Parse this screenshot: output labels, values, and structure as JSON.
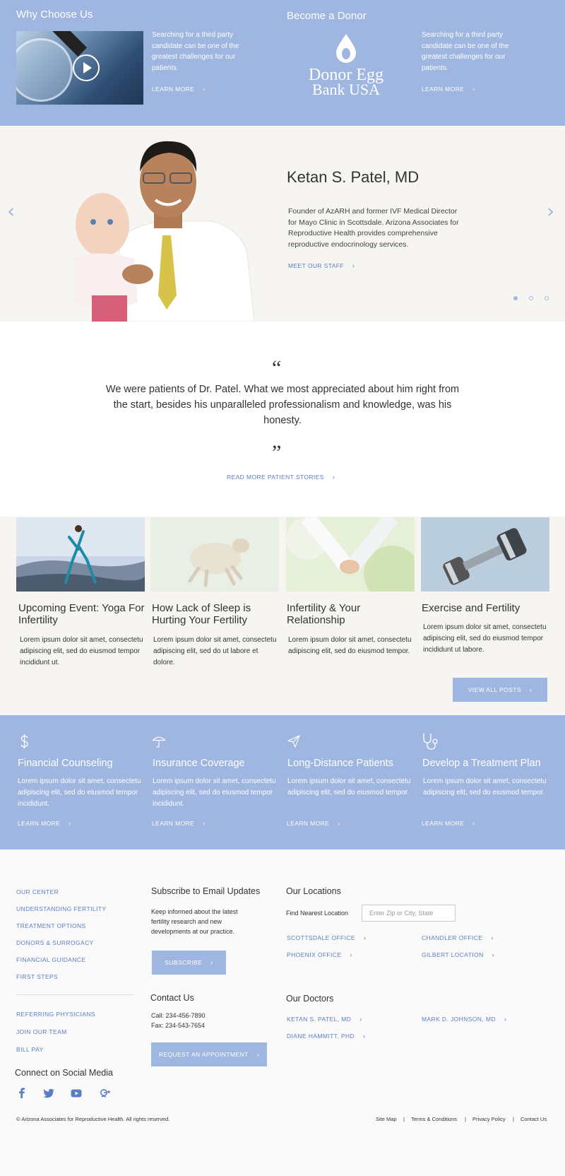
{
  "top": {
    "why": {
      "heading": "Why Choose Us",
      "text": "Searching for a third party candidate can be one of the greatest challenges for our patients.",
      "link": "LEARN MORE"
    },
    "donor": {
      "heading": "Become a Donor",
      "logo_line1": "Donor Egg",
      "logo_line2": "Bank USA",
      "text": "Searching for a third party candidate can be one of the greatest challenges for our patients.",
      "link": "LEARN MORE"
    }
  },
  "hero": {
    "name": "Ketan S. Patel, MD",
    "bio": "Founder of AzARH and former IVF Medical Director for Mayo Clinic in Scottsdale. Arizona Associates for Reproductive Health provides comprehensive reproductive endocrinology services.",
    "link": "MEET OUR STAFF",
    "slide_count": 3,
    "active_slide": 1
  },
  "testimonial": {
    "open_quote": "“",
    "close_quote": "”",
    "text": "We were patients of Dr. Patel. What we most appreciated about him right from the start, besides his unparalleled professionalism and knowledge, was his honesty.",
    "link": "READ MORE PATIENT STORIES"
  },
  "posts": [
    {
      "title": "Upcoming Event: Yoga For Infertility",
      "excerpt": "Lorem ipsum dolor sit amet, consectetu adipiscing elit, sed do eiusmod tempor incididunt ut."
    },
    {
      "title": "How Lack of Sleep is Hurting Your Fertility",
      "excerpt": "Lorem ipsum dolor sit amet, consectetu adipiscing elit, sed do ut labore et dolore."
    },
    {
      "title": "Infertility & Your Relationship",
      "excerpt": "Lorem ipsum dolor sit amet, consectetu adipiscing elit, sed do eiusmod tempor."
    },
    {
      "title": "Exercise and Fertility",
      "excerpt": "Lorem ipsum dolor sit amet, consectetu adipiscing elit, sed do eiusmod tempor incididunt ut labore."
    }
  ],
  "view_all": "VIEW ALL POSTS",
  "services": [
    {
      "icon": "dollar-icon",
      "title": "Financial Counseling",
      "text": "Lorem ipsum dolor sit amet, consectetu adipiscing elit, sed do eiusmod tempor incididunt.",
      "link": "LEARN MORE"
    },
    {
      "icon": "umbrella-icon",
      "title": "Insurance Coverage",
      "text": "Lorem ipsum dolor sit amet, consectetu adipiscing elit, sed do eiusmod tempor incididunt.",
      "link": "LEARN MORE"
    },
    {
      "icon": "paper-plane-icon",
      "title": "Long-Distance Patients",
      "text": "Lorem ipsum dolor sit amet, consectetu adipiscing elit, sed do eiusmod tempor.",
      "link": "LEARN MORE"
    },
    {
      "icon": "stethoscope-icon",
      "title": "Develop a Treatment Plan",
      "text": "Lorem ipsum dolor sit amet, consectetu adipiscing elit, sed do eiusmod tempor.",
      "link": "LEARN MORE"
    }
  ],
  "footer": {
    "nav": [
      "OUR CENTER",
      "UNDERSTANDING FERTILITY",
      "TREATMENT OPTIONS",
      "DONORS & SURROGACY",
      "FINANCIAL GUIDANCE",
      "FIRST STEPS"
    ],
    "nav2": [
      "REFERRING PHYSICIANS",
      "JOIN OUR TEAM",
      "BILL PAY"
    ],
    "social_heading": "Connect on Social Media",
    "social_icons": [
      "facebook-icon",
      "twitter-icon",
      "youtube-icon",
      "google-plus-icon"
    ],
    "subscribe": {
      "heading": "Subscribe to Email Updates",
      "text": "Keep informed about the latest fertility research and new developments at our practice.",
      "button": "SUBSCRIBE"
    },
    "contact": {
      "heading": "Contact Us",
      "call": "Call: 234-456-7890",
      "fax": "Fax: 234-543-7654",
      "button": "REQUEST AN APPOINTMENT"
    },
    "locations": {
      "heading": "Our Locations",
      "find_label": "Find Nearest Location",
      "placeholder": "Enter Zip or City, State",
      "offices": [
        "SCOTTSDALE OFFICE",
        "CHANDLER OFFICE",
        "PHOENIX OFFICE",
        "GILBERT LOCATION"
      ]
    },
    "doctors": {
      "heading": "Our Doctors",
      "list": [
        "KETAN S. PATEL, MD",
        "MARK D. JOHNSON, MD",
        "DIANE HAMMITT, PHD"
      ]
    },
    "copyright": "© Arizona Associates for Reproductive Health. All rights reserved.",
    "legal_links": [
      "Site Map",
      "Terms & Conditions",
      "Privacy Policy",
      "Contact Us"
    ],
    "separator": "|"
  },
  "colors": {
    "accent": "#9fb6e0",
    "link": "#5b7dc4",
    "cream": "#f7f5f1"
  }
}
